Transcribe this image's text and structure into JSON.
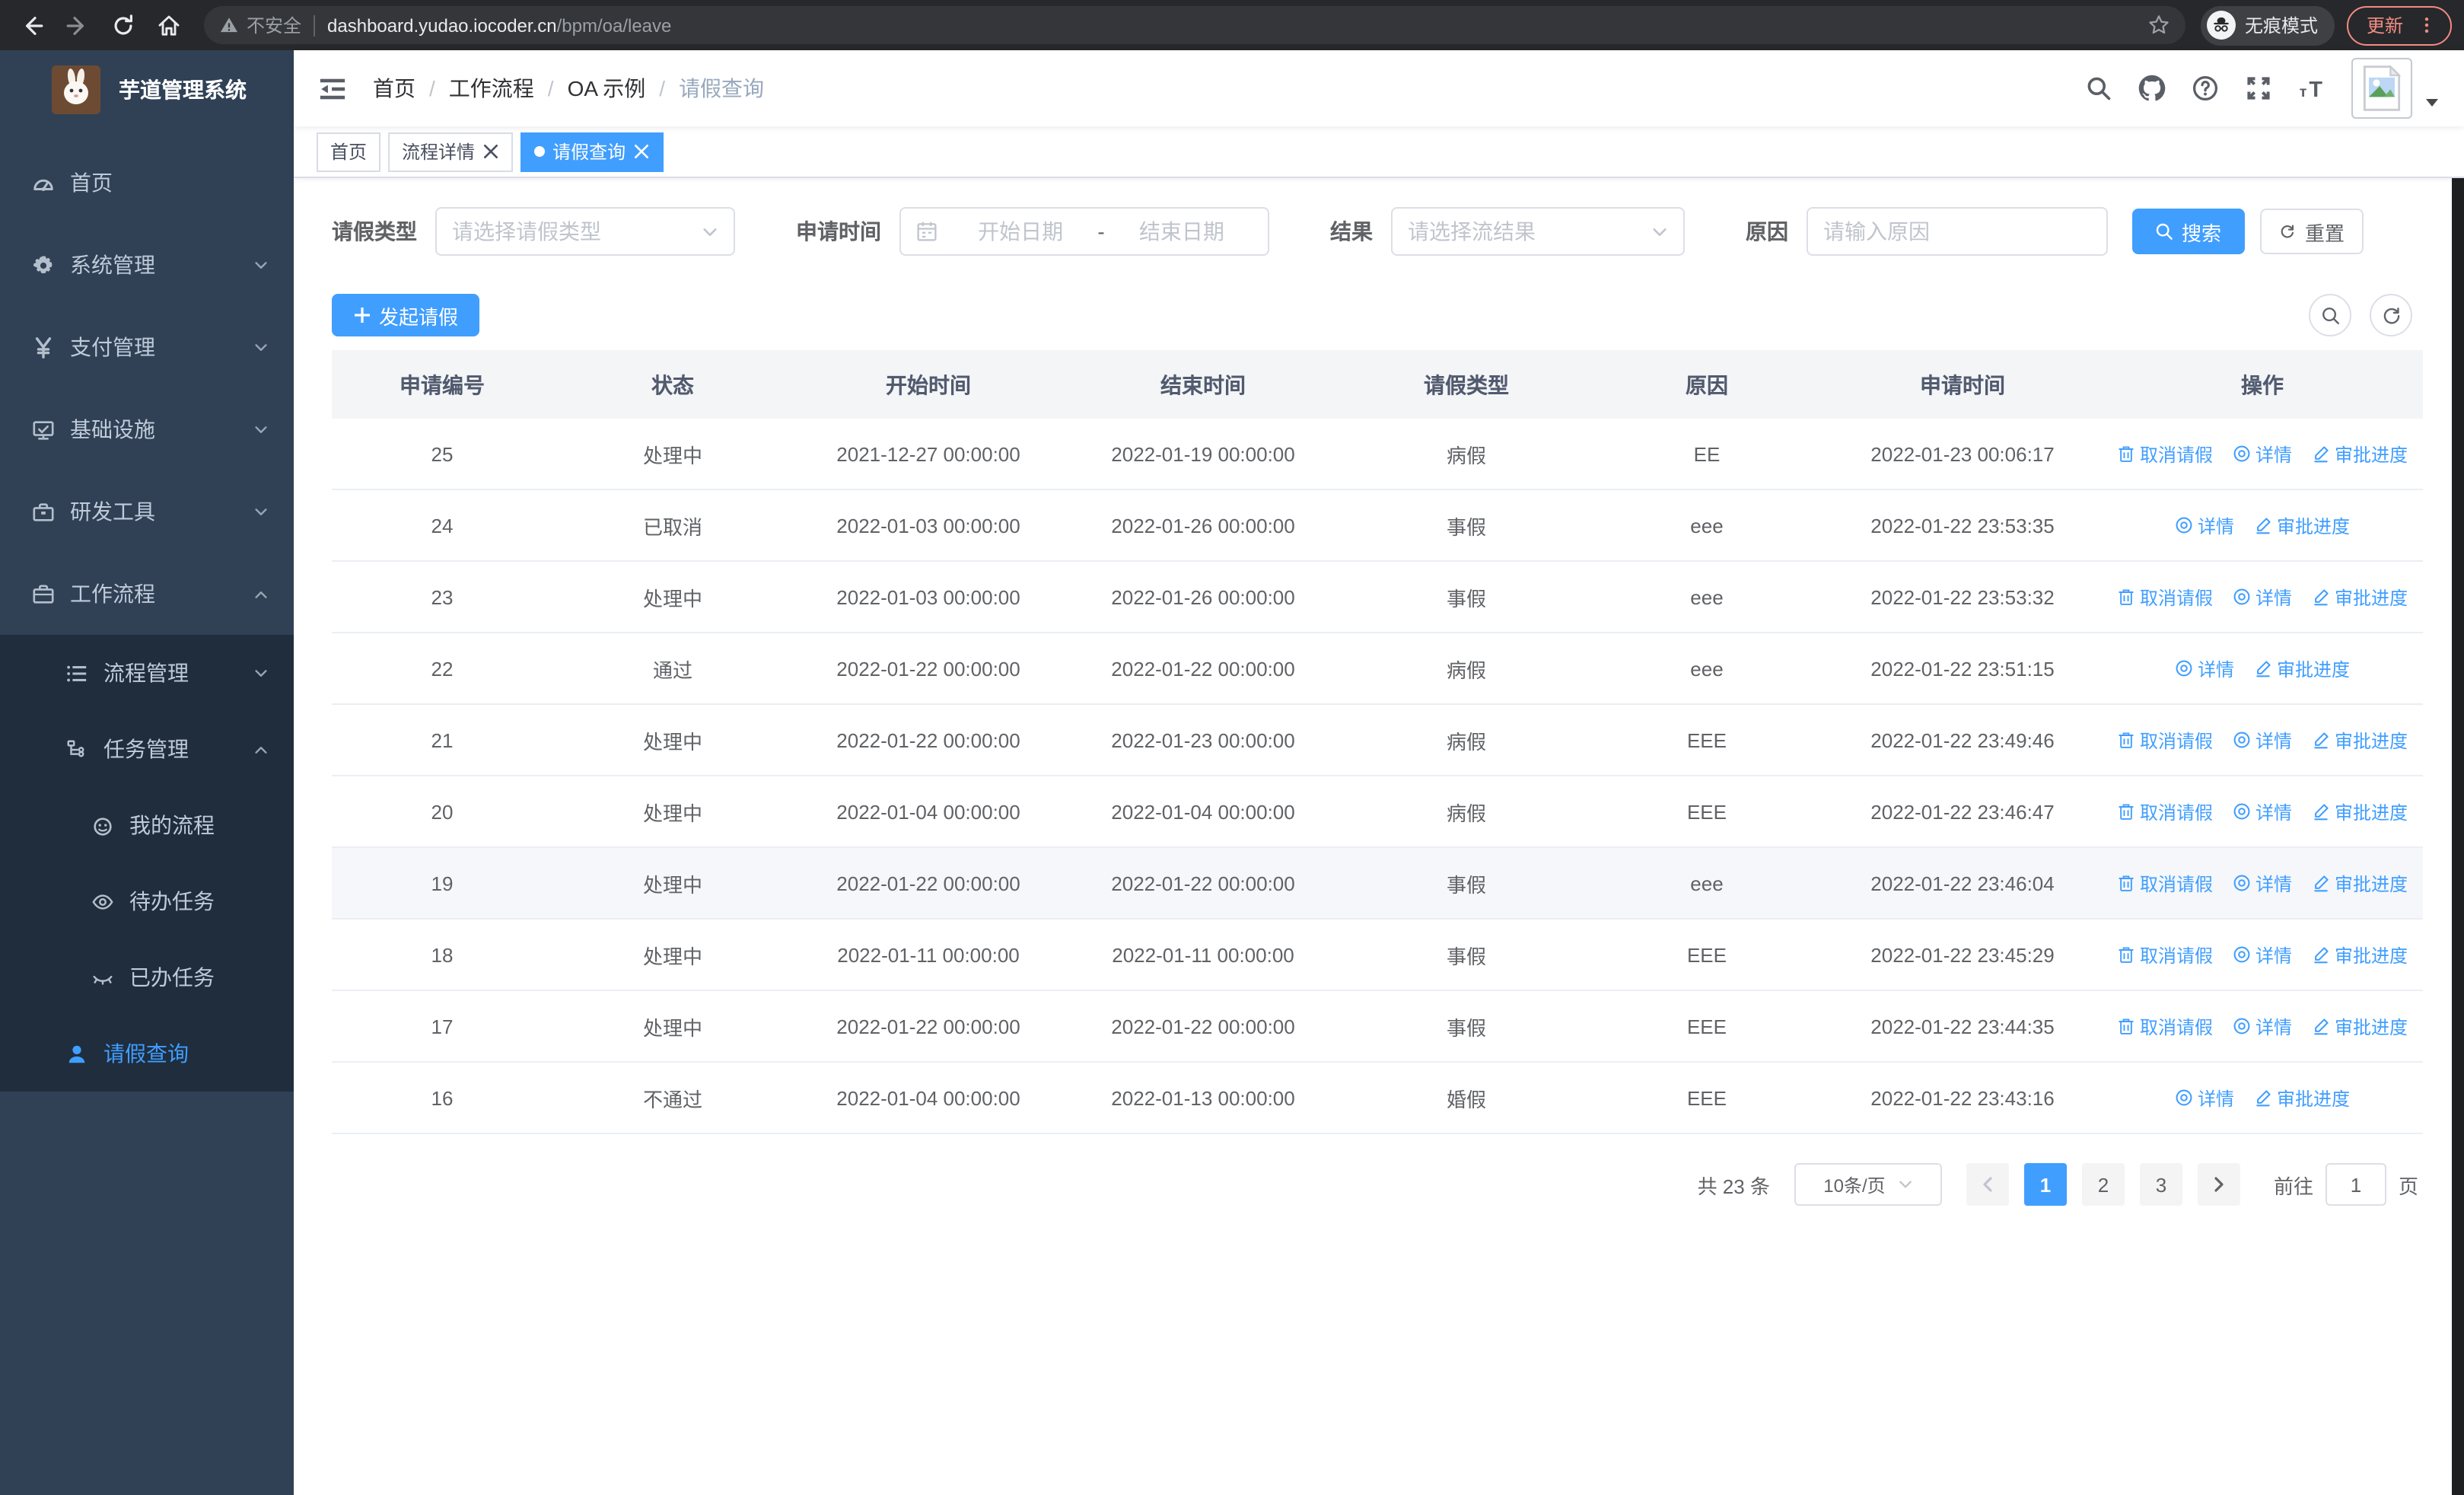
{
  "colors": {
    "accent": "#409eff",
    "sidebar_bg": "#304156",
    "sidebar_submenu_bg": "#1f2d3d",
    "active_tab_bg": "#409eff",
    "update_button": "#f28b82"
  },
  "browser": {
    "security_label": "不安全",
    "url_domain": "dashboard.yudao.iocoder.cn",
    "url_path": "/bpm/oa/leave",
    "incognito_label": "无痕模式",
    "update_label": "更新"
  },
  "sidebar": {
    "title": "芋道管理系统",
    "menu": [
      {
        "label": "首页",
        "icon": "dashboard",
        "level": 0,
        "sub": false,
        "arrow": "",
        "active": false
      },
      {
        "label": "系统管理",
        "icon": "gear",
        "level": 0,
        "sub": false,
        "arrow": "down",
        "active": false
      },
      {
        "label": "支付管理",
        "icon": "yen",
        "level": 0,
        "sub": false,
        "arrow": "down",
        "active": false
      },
      {
        "label": "基础设施",
        "icon": "monitor",
        "level": 0,
        "sub": false,
        "arrow": "down",
        "active": false
      },
      {
        "label": "研发工具",
        "icon": "toolbox",
        "level": 0,
        "sub": false,
        "arrow": "down",
        "active": false
      },
      {
        "label": "工作流程",
        "icon": "briefcase",
        "level": 0,
        "sub": false,
        "arrow": "up",
        "active": false
      },
      {
        "label": "流程管理",
        "icon": "list",
        "level": 1,
        "sub": true,
        "arrow": "down",
        "active": false
      },
      {
        "label": "任务管理",
        "icon": "flow",
        "level": 1,
        "sub": true,
        "arrow": "up",
        "active": false
      },
      {
        "label": "我的流程",
        "icon": "face",
        "level": 2,
        "sub": true,
        "arrow": "",
        "active": false
      },
      {
        "label": "待办任务",
        "icon": "eye-open",
        "level": 2,
        "sub": true,
        "arrow": "",
        "active": false
      },
      {
        "label": "已办任务",
        "icon": "eye-closed",
        "level": 2,
        "sub": true,
        "arrow": "",
        "active": false
      },
      {
        "label": "请假查询",
        "icon": "user",
        "level": 1,
        "sub": true,
        "arrow": "",
        "active": true
      }
    ]
  },
  "navbar": {
    "separator": "/",
    "breadcrumb": [
      {
        "label": "首页",
        "muted": false
      },
      {
        "label": "工作流程",
        "muted": false
      },
      {
        "label": "OA 示例",
        "muted": false
      },
      {
        "label": "请假查询",
        "muted": true
      }
    ]
  },
  "tabs": [
    {
      "label": "首页",
      "closable": false,
      "active": false
    },
    {
      "label": "流程详情",
      "closable": true,
      "active": false
    },
    {
      "label": "请假查询",
      "closable": true,
      "active": true
    }
  ],
  "filters": {
    "leave_type": {
      "label": "请假类型",
      "placeholder": "请选择请假类型"
    },
    "apply_time": {
      "label": "申请时间",
      "start_placeholder": "开始日期",
      "separator": "-",
      "end_placeholder": "结束日期"
    },
    "result": {
      "label": "结果",
      "placeholder": "请选择流结果"
    },
    "reason": {
      "label": "原因",
      "placeholder": "请输入原因"
    },
    "search_label": "搜索",
    "reset_label": "重置"
  },
  "toolbar": {
    "create_label": "发起请假"
  },
  "table": {
    "columns": [
      "申请编号",
      "状态",
      "开始时间",
      "结束时间",
      "请假类型",
      "原因",
      "申请时间",
      "操作"
    ],
    "action_labels": {
      "cancel": "取消请假",
      "detail": "详情",
      "progress": "审批进度"
    },
    "rows": [
      {
        "id": "25",
        "status": "处理中",
        "start": "2021-12-27 00:00:00",
        "end": "2022-01-19 00:00:00",
        "type": "病假",
        "reason": "EE",
        "apply_time": "2022-01-23 00:06:17",
        "actions": [
          "cancel",
          "detail",
          "progress"
        ],
        "highlighted": false
      },
      {
        "id": "24",
        "status": "已取消",
        "start": "2022-01-03 00:00:00",
        "end": "2022-01-26 00:00:00",
        "type": "事假",
        "reason": "eee",
        "apply_time": "2022-01-22 23:53:35",
        "actions": [
          "detail",
          "progress"
        ],
        "highlighted": false
      },
      {
        "id": "23",
        "status": "处理中",
        "start": "2022-01-03 00:00:00",
        "end": "2022-01-26 00:00:00",
        "type": "事假",
        "reason": "eee",
        "apply_time": "2022-01-22 23:53:32",
        "actions": [
          "cancel",
          "detail",
          "progress"
        ],
        "highlighted": false
      },
      {
        "id": "22",
        "status": "通过",
        "start": "2022-01-22 00:00:00",
        "end": "2022-01-22 00:00:00",
        "type": "病假",
        "reason": "eee",
        "apply_time": "2022-01-22 23:51:15",
        "actions": [
          "detail",
          "progress"
        ],
        "highlighted": false
      },
      {
        "id": "21",
        "status": "处理中",
        "start": "2022-01-22 00:00:00",
        "end": "2022-01-23 00:00:00",
        "type": "病假",
        "reason": "EEE",
        "apply_time": "2022-01-22 23:49:46",
        "actions": [
          "cancel",
          "detail",
          "progress"
        ],
        "highlighted": false
      },
      {
        "id": "20",
        "status": "处理中",
        "start": "2022-01-04 00:00:00",
        "end": "2022-01-04 00:00:00",
        "type": "病假",
        "reason": "EEE",
        "apply_time": "2022-01-22 23:46:47",
        "actions": [
          "cancel",
          "detail",
          "progress"
        ],
        "highlighted": false
      },
      {
        "id": "19",
        "status": "处理中",
        "start": "2022-01-22 00:00:00",
        "end": "2022-01-22 00:00:00",
        "type": "事假",
        "reason": "eee",
        "apply_time": "2022-01-22 23:46:04",
        "actions": [
          "cancel",
          "detail",
          "progress"
        ],
        "highlighted": true
      },
      {
        "id": "18",
        "status": "处理中",
        "start": "2022-01-11 00:00:00",
        "end": "2022-01-11 00:00:00",
        "type": "事假",
        "reason": "EEE",
        "apply_time": "2022-01-22 23:45:29",
        "actions": [
          "cancel",
          "detail",
          "progress"
        ],
        "highlighted": false
      },
      {
        "id": "17",
        "status": "处理中",
        "start": "2022-01-22 00:00:00",
        "end": "2022-01-22 00:00:00",
        "type": "事假",
        "reason": "EEE",
        "apply_time": "2022-01-22 23:44:35",
        "actions": [
          "cancel",
          "detail",
          "progress"
        ],
        "highlighted": false
      },
      {
        "id": "16",
        "status": "不通过",
        "start": "2022-01-04 00:00:00",
        "end": "2022-01-13 00:00:00",
        "type": "婚假",
        "reason": "EEE",
        "apply_time": "2022-01-22 23:43:16",
        "actions": [
          "detail",
          "progress"
        ],
        "highlighted": false
      }
    ]
  },
  "pagination": {
    "total_label": "共 23 条",
    "page_size_label": "10条/页",
    "pages": [
      "1",
      "2",
      "3"
    ],
    "active_page": "1",
    "goto_label": "前往",
    "goto_value": "1",
    "goto_suffix": "页"
  }
}
